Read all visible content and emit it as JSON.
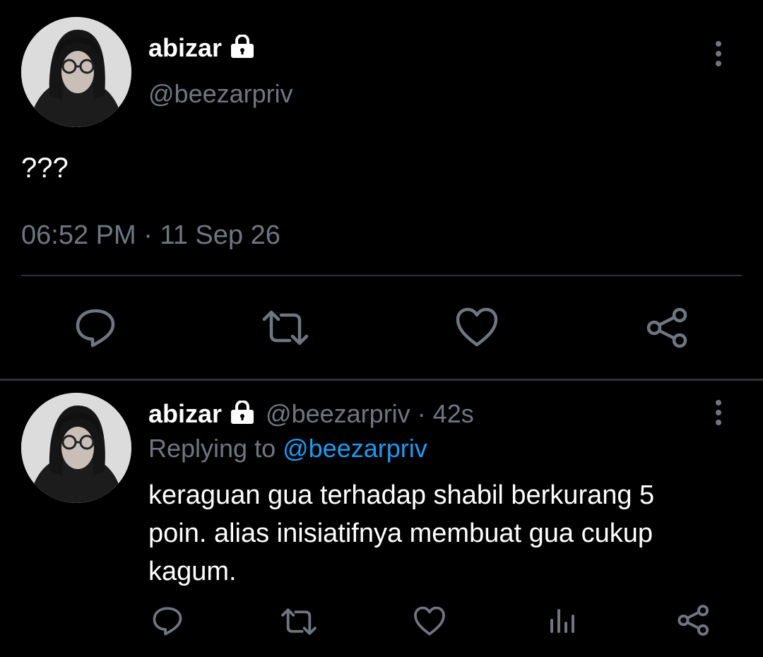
{
  "main_tweet": {
    "display_name": "abizar",
    "handle": "@beezarpriv",
    "text": "???",
    "timestamp": "06:52 PM · 11 Sep 26",
    "actions": {
      "reply_icon": "reply-icon",
      "retweet_icon": "retweet-icon",
      "like_icon": "like-icon",
      "share_icon": "share-icon"
    },
    "more_icon": "more-vertical-icon"
  },
  "reply_tweet": {
    "display_name": "abizar",
    "handle_time": "@beezarpriv · 42s",
    "replying_prefix": "Replying to ",
    "replying_handle": "@beezarpriv",
    "text_lines": [
      "keraguan gua terhadap shabil berkurang 5",
      "poin. alias inisiatifnya membuat gua cukup",
      "kagum."
    ],
    "actions": {
      "reply_icon": "reply-icon",
      "retweet_icon": "retweet-icon",
      "like_icon": "like-icon",
      "analytics_icon": "analytics-icon",
      "share_icon": "share-icon"
    },
    "more_icon": "more-vertical-icon"
  },
  "colors": {
    "background": "#000000",
    "muted": "#6e7781",
    "link": "#1d9bf0",
    "divider": "#2f3336"
  }
}
